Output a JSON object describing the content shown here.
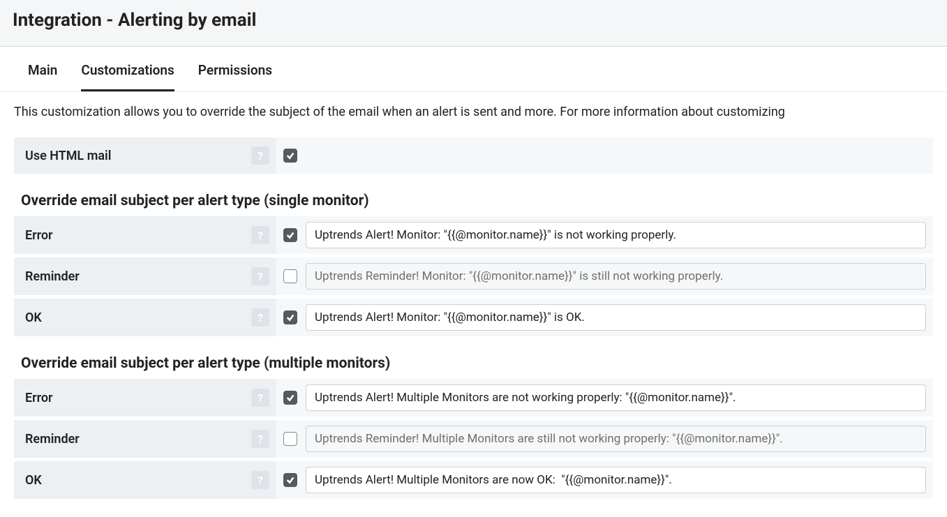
{
  "header": {
    "title": "Integration - Alerting by email"
  },
  "tabs": [
    {
      "label": "Main",
      "active": false
    },
    {
      "label": "Customizations",
      "active": true
    },
    {
      "label": "Permissions",
      "active": false
    }
  ],
  "description": "This customization allows you to override the subject of the email when an alert is sent and more. For more information about customizing",
  "html_mail": {
    "label": "Use HTML mail",
    "checked": true
  },
  "sections": [
    {
      "title": "Override email subject per alert type (single monitor)",
      "rows": [
        {
          "label": "Error",
          "checked": true,
          "value": "Uptrends Alert! Monitor: \"{{@monitor.name}}\" is not working properly."
        },
        {
          "label": "Reminder",
          "checked": false,
          "value": "Uptrends Reminder! Monitor: \"{{@monitor.name}}\" is still not working properly."
        },
        {
          "label": "OK",
          "checked": true,
          "value": "Uptrends Alert! Monitor: \"{{@monitor.name}}\" is OK."
        }
      ]
    },
    {
      "title": "Override email subject per alert type (multiple monitors)",
      "rows": [
        {
          "label": "Error",
          "checked": true,
          "value": "Uptrends Alert! Multiple Monitors are not working properly: \"{{@monitor.name}}\"."
        },
        {
          "label": "Reminder",
          "checked": false,
          "value": "Uptrends Reminder! Multiple Monitors are still not working properly: \"{{@monitor.name}}\"."
        },
        {
          "label": "OK",
          "checked": true,
          "value": "Uptrends Alert! Multiple Monitors are now OK:  \"{{@monitor.name}}\"."
        }
      ]
    }
  ]
}
